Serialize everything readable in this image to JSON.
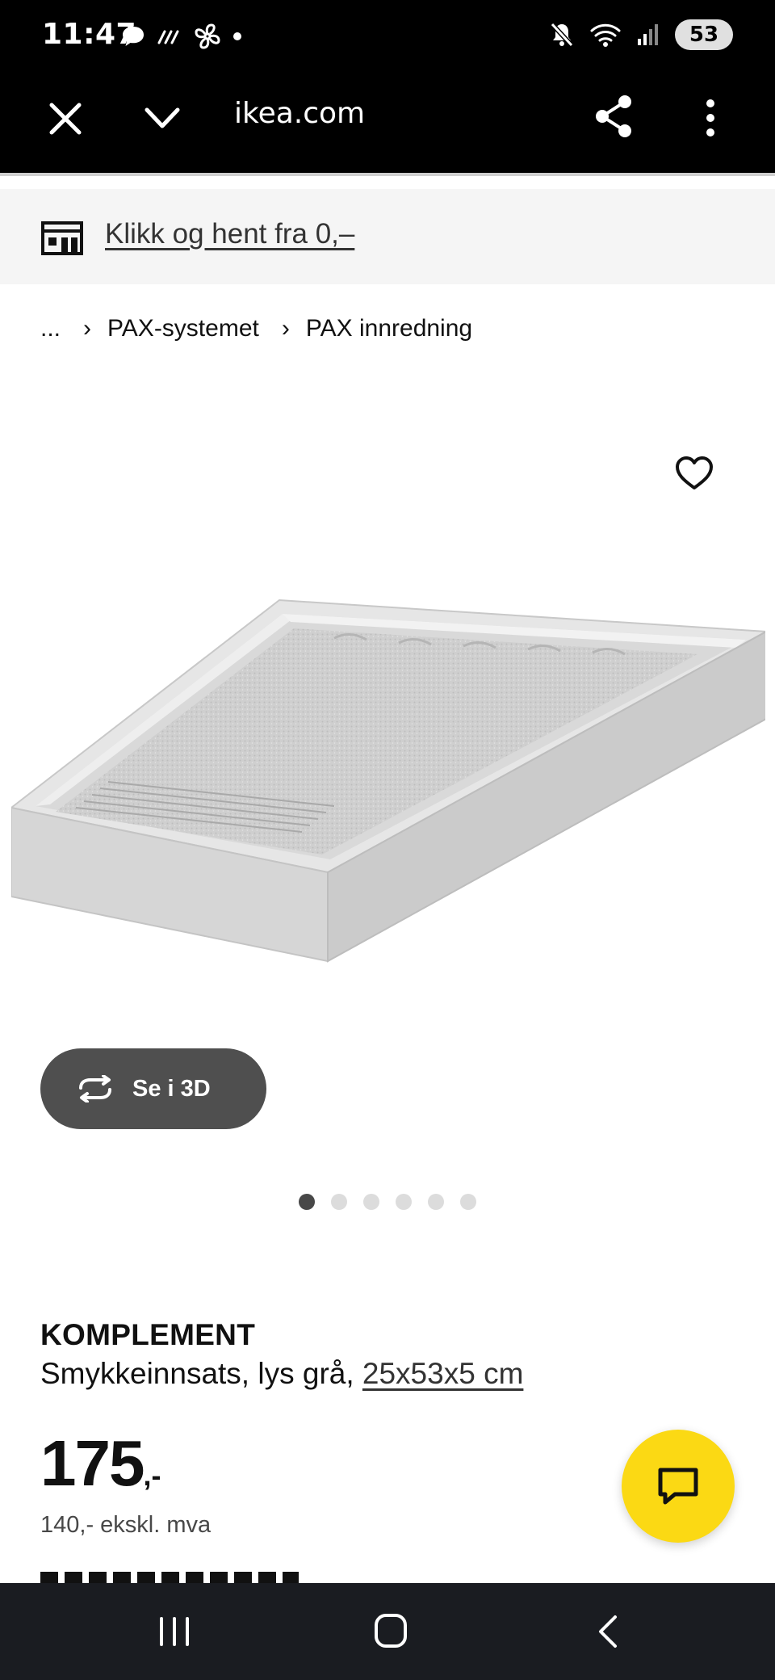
{
  "status_bar": {
    "time": "11:47",
    "battery": "53",
    "left_icons": [
      "chat-bubble-icon",
      "signal-wave-icon",
      "fan-icon",
      "dot-icon"
    ],
    "right_icons": [
      "mute-icon",
      "wifi-icon",
      "cellular-signal-icon",
      "battery-icon"
    ]
  },
  "browser": {
    "url": "ikea.com"
  },
  "banner": {
    "text": "Klikk og hent fra 0,–"
  },
  "breadcrumb": {
    "items": [
      "...",
      "PAX-systemet",
      "PAX innredning"
    ]
  },
  "view_3d": {
    "label": "Se i 3D"
  },
  "carousel": {
    "total": 6,
    "active_index": 0
  },
  "product": {
    "name": "KOMPLEMENT",
    "description": "Smykkeinnsats, lys grå, ",
    "dimensions": "25x53x5 cm",
    "price_main": "175",
    "price_suffix": ",-",
    "price_ex_vat": "140,- ekskl. mva"
  },
  "colors": {
    "chat_button": "#fbd914",
    "toolbar": "#000000",
    "banner_bg": "#f5f5f5",
    "button_3d": "#4f4f4f"
  }
}
